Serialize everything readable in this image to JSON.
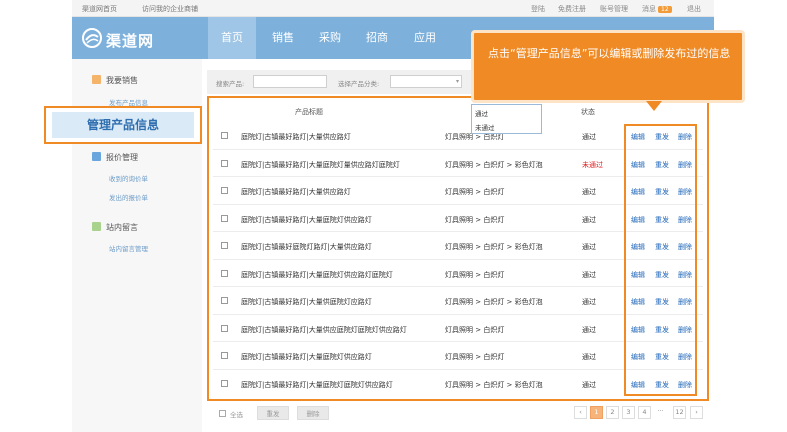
{
  "topbar": {
    "home": "渠道网首页",
    "visit_shop": "访问我的企业商铺",
    "login": "登陆",
    "register": "免费注册",
    "account": "账号管理",
    "messages": "消息",
    "message_count": "12",
    "logout": "退出"
  },
  "header": {
    "logo_text": "渠道网",
    "nav": [
      "首页",
      "销售",
      "采购",
      "招商",
      "应用"
    ],
    "active_index": 0
  },
  "sidebar": {
    "sections": [
      {
        "title": "我要销售",
        "links": [
          "发布产品信息"
        ]
      },
      {
        "title": "报价管理",
        "links": [
          "收到的询价单",
          "发出的报价单"
        ]
      },
      {
        "title": "站内留言",
        "links": [
          "站内留言管理"
        ]
      }
    ],
    "highlight": "管理产品信息"
  },
  "filter": {
    "search_label": "搜索产品:",
    "search_value": "",
    "category_label": "选择产品分类:",
    "category_value": "",
    "status_options": [
      "通过",
      "未通过"
    ]
  },
  "table": {
    "col_title": "产品标题",
    "col_status": "状态",
    "rows": [
      {
        "title": "庭院灯|古镇最好路灯|大量供应路灯",
        "category": "灯具照明 > 白炽灯",
        "status": "通过",
        "bad": false
      },
      {
        "title": "庭院灯|古镇最好路灯|大量庭院灯量供应路灯庭院灯",
        "category": "灯具照明 > 白炽灯 > 彩色灯泡",
        "status": "未通过",
        "bad": true
      },
      {
        "title": "庭院灯|古镇最好路灯|大量供应路灯",
        "category": "灯具照明 > 白炽灯",
        "status": "通过",
        "bad": false
      },
      {
        "title": "庭院灯|古镇最好路灯|大量庭院灯供应路灯",
        "category": "灯具照明 > 白炽灯",
        "status": "通过",
        "bad": false
      },
      {
        "title": "庭院灯|古镇最好庭院灯路灯|大量供应路灯",
        "category": "灯具照明 > 白炽灯 > 彩色灯泡",
        "status": "通过",
        "bad": false
      },
      {
        "title": "庭院灯|古镇最好路灯|大量庭院灯供应路灯庭院灯",
        "category": "灯具照明 > 白炽灯",
        "status": "通过",
        "bad": false
      },
      {
        "title": "庭院灯|古镇最好路灯|大量供庭院灯应路灯",
        "category": "灯具照明 > 白炽灯 > 彩色灯泡",
        "status": "通过",
        "bad": false
      },
      {
        "title": "庭院灯|古镇最好路灯|大量供应庭院灯庭院灯供应路灯",
        "category": "灯具照明 > 白炽灯",
        "status": "通过",
        "bad": false
      },
      {
        "title": "庭院灯|古镇最好路灯|大量庭院灯供应路灯",
        "category": "灯具照明 > 白炽灯",
        "status": "通过",
        "bad": false
      },
      {
        "title": "庭院灯|古镇最好路灯|大量庭院灯庭院灯供应路灯",
        "category": "灯具照明 > 白炽灯 > 彩色灯泡",
        "status": "通过",
        "bad": false
      }
    ],
    "actions": [
      "编辑",
      "重发",
      "删除"
    ]
  },
  "footer": {
    "select_all": "全选",
    "resend": "重发",
    "delete": "删除",
    "pages": [
      "1",
      "2",
      "3",
      "4",
      "···",
      "12"
    ],
    "current_page": "1"
  },
  "callout": {
    "text": "点击“管理产品信息”可以编辑或删除发布过的信息"
  },
  "colors": {
    "header_bg": "#7db1dc",
    "highlight_orange": "#f08a24",
    "link_blue": "#1f66b8",
    "error_red": "#e02020"
  }
}
